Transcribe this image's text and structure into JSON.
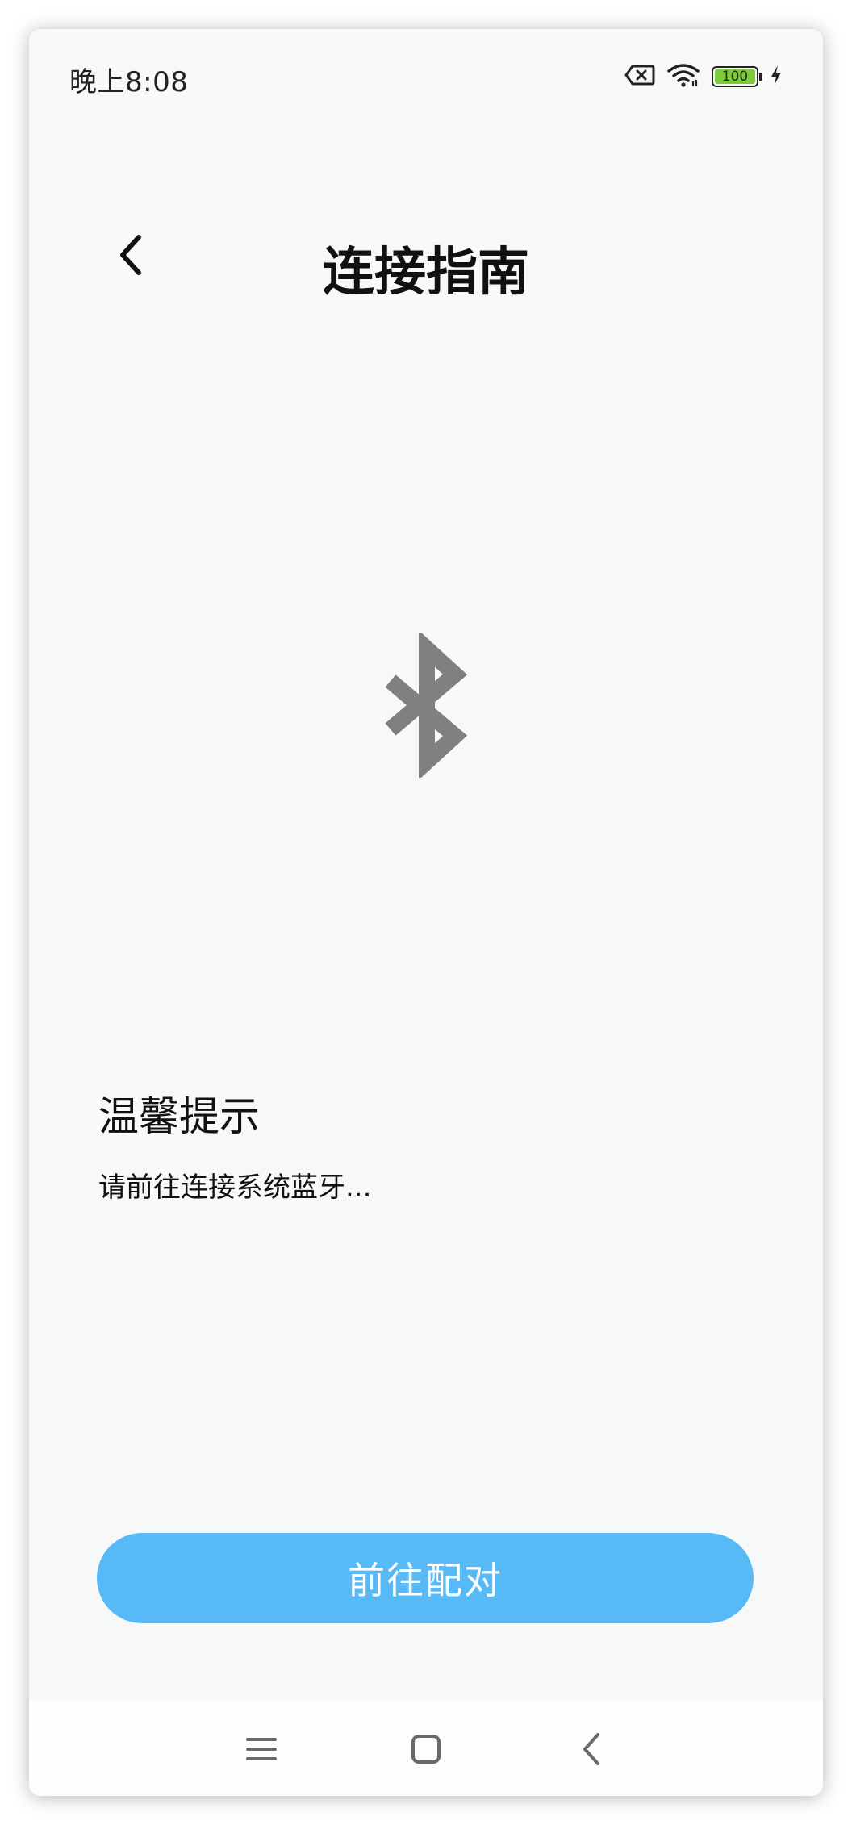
{
  "status_bar": {
    "time": "晚上8:08",
    "battery_level": "100",
    "icons": [
      "sim-off-icon",
      "wifi-icon",
      "battery-icon",
      "charging-icon"
    ]
  },
  "header": {
    "title": "连接指南",
    "back_icon": "chevron-left-icon"
  },
  "illustration": {
    "icon": "bluetooth-icon",
    "color": "#808080"
  },
  "tip": {
    "title": "温馨提示",
    "message": "请前往连接系统蓝牙..."
  },
  "primary_action": {
    "label": "前往配对",
    "color": "#58b9f7"
  },
  "nav_bar": {
    "icons": [
      "menu-icon",
      "home-icon",
      "back-icon"
    ]
  }
}
